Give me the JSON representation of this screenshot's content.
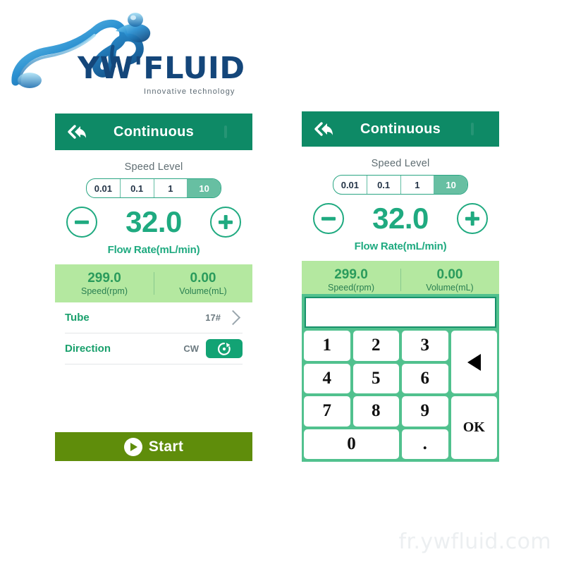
{
  "brand": {
    "name": "YW'FLUID",
    "tagline": "Innovative technology",
    "logo_icon": "water-splash-icon",
    "color": "#14467a"
  },
  "watermark": "fr.ywfluid.com",
  "colors": {
    "header_green": "#0e8a66",
    "accent_teal": "#1faa80",
    "stats_band": "#b4e8a0",
    "start_olive": "#5f8d0b",
    "keypad_green": "#51c18e"
  },
  "panels": [
    {
      "id": "left",
      "header": {
        "title": "Continuous",
        "back_icon": "back-double-arrow-icon"
      },
      "speed_level": {
        "label": "Speed Level",
        "options": [
          "0.01",
          "0.1",
          "1",
          "10"
        ],
        "selected": "10"
      },
      "flow_rate": {
        "value": "32.0",
        "caption": "Flow Rate(mL/min)",
        "decrease_icon": "minus-circle-icon",
        "increase_icon": "plus-circle-icon"
      },
      "stats": [
        {
          "value": "299.0",
          "caption": "Speed(rpm)"
        },
        {
          "value": "0.00",
          "caption": "Volume(mL)"
        }
      ],
      "rows": [
        {
          "label": "Tube",
          "value": "17#",
          "icon": "chevron-right-icon"
        },
        {
          "label": "Direction",
          "value": "CW",
          "icon": "rotate-clockwise-icon"
        }
      ],
      "start": {
        "label": "Start",
        "icon": "play-icon"
      }
    },
    {
      "id": "right",
      "header": {
        "title": "Continuous",
        "back_icon": "back-double-arrow-icon"
      },
      "speed_level": {
        "label": "Speed Level",
        "options": [
          "0.01",
          "0.1",
          "1",
          "10"
        ],
        "selected": "10"
      },
      "flow_rate": {
        "value": "32.0",
        "caption": "Flow Rate(mL/min)",
        "decrease_icon": "minus-circle-icon",
        "increase_icon": "plus-circle-icon"
      },
      "stats": [
        {
          "value": "299.0",
          "caption": "Speed(rpm)"
        },
        {
          "value": "0.00",
          "caption": "Volume(mL)"
        }
      ],
      "keypad": {
        "display_value": "",
        "keys": [
          "1",
          "2",
          "3",
          "4",
          "5",
          "6",
          "7",
          "8",
          "9",
          "0",
          "."
        ],
        "backspace_icon": "backspace-arrow-icon",
        "confirm_label": "OK"
      }
    }
  ]
}
